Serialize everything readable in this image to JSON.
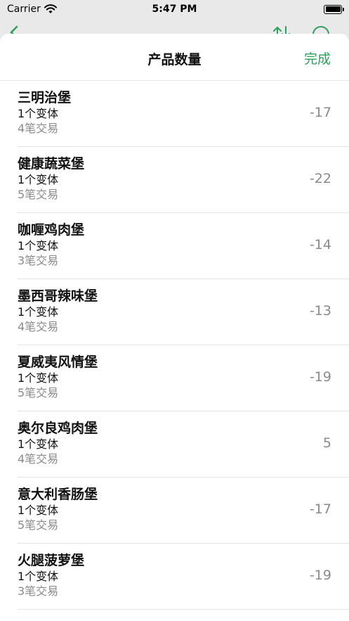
{
  "status": {
    "carrier": "Carrier",
    "time": "5:47 PM"
  },
  "sheet": {
    "title": "产品数量",
    "done_label": "完成"
  },
  "products": [
    {
      "name": "三明治堡",
      "variants": "1个变体",
      "transactions": "4笔交易",
      "quantity": "-17"
    },
    {
      "name": "健康蔬菜堡",
      "variants": "1个变体",
      "transactions": "5笔交易",
      "quantity": "-22"
    },
    {
      "name": "咖喱鸡肉堡",
      "variants": "1个变体",
      "transactions": "3笔交易",
      "quantity": "-14"
    },
    {
      "name": "墨西哥辣味堡",
      "variants": "1个变体",
      "transactions": "4笔交易",
      "quantity": "-13"
    },
    {
      "name": "夏威夷风情堡",
      "variants": "1个变体",
      "transactions": "5笔交易",
      "quantity": "-19"
    },
    {
      "name": "奥尔良鸡肉堡",
      "variants": "1个变体",
      "transactions": "4笔交易",
      "quantity": "5"
    },
    {
      "name": "意大利香肠堡",
      "variants": "1个变体",
      "transactions": "5笔交易",
      "quantity": "-17"
    },
    {
      "name": "火腿菠萝堡",
      "variants": "1个变体",
      "transactions": "3笔交易",
      "quantity": "-19"
    }
  ],
  "colors": {
    "accent": "#2e9e5b",
    "secondary_text": "#8a8a8a",
    "separator": "#e3e3e3"
  },
  "icons": {
    "wifi": "wifi-icon",
    "battery": "battery-icon",
    "back": "chevron-left-icon",
    "sort": "sort-icon",
    "search": "search-icon"
  }
}
